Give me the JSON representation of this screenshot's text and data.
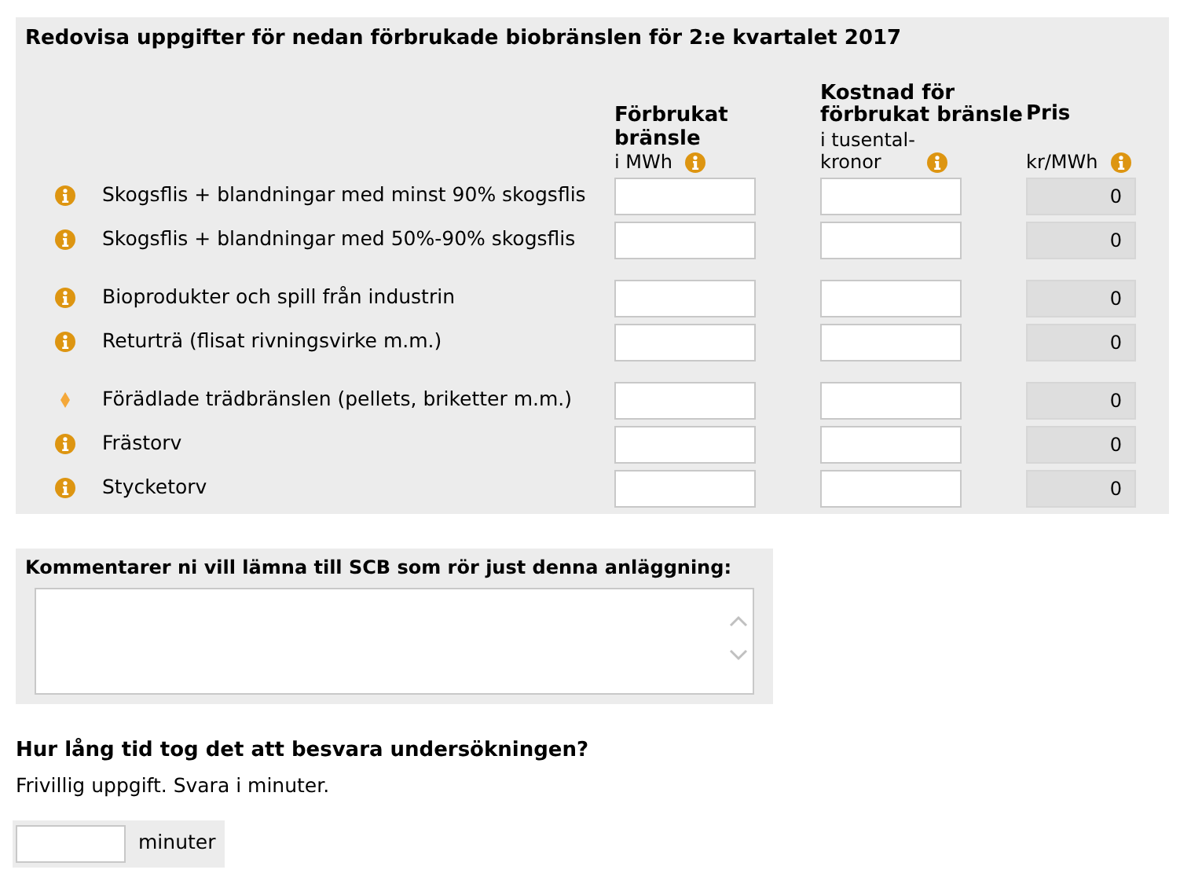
{
  "fuel_section": {
    "title": "Redovisa uppgifter för nedan förbrukade biobränslen för 2:e kvartalet 2017",
    "columns": [
      {
        "title_lines": [
          "Förbrukat",
          "bränsle"
        ],
        "unit_lines": [
          "i MWh"
        ]
      },
      {
        "title_lines": [
          "Kostnad för",
          "förbrukat bränsle"
        ],
        "unit_lines": [
          "i tusental-",
          "kronor"
        ]
      },
      {
        "title_lines": [
          "Pris"
        ],
        "unit_lines": [
          "kr/MWh"
        ]
      }
    ],
    "groups": [
      {
        "rows": [
          {
            "label": "Skogsflis + blandningar med minst 90% skogsflis",
            "kind": "info",
            "price": "0"
          },
          {
            "label": "Skogsflis + blandningar med 50%-90% skogsflis",
            "kind": "info",
            "price": "0"
          }
        ]
      },
      {
        "rows": [
          {
            "label": "Bioprodukter och spill från industrin",
            "kind": "info",
            "price": "0"
          },
          {
            "label": "Returträ (flisat rivningsvirke m.m.)",
            "kind": "info",
            "price": "0"
          }
        ]
      },
      {
        "rows": [
          {
            "label": "Förädlade trädbränslen (pellets, briketter m.m.)",
            "kind": "diamond",
            "price": "0"
          },
          {
            "label": "Frästorv",
            "kind": "info",
            "price": "0"
          },
          {
            "label": "Stycketorv",
            "kind": "info",
            "price": "0"
          }
        ]
      }
    ]
  },
  "comments": {
    "label": "Kommentarer ni vill lämna till SCB som rör just denna anläggning:"
  },
  "duration": {
    "question": "Hur lång tid tog det att besvara undersökningen?",
    "note": "Frivillig uppgift. Svara i minuter.",
    "unit": "minuter"
  }
}
